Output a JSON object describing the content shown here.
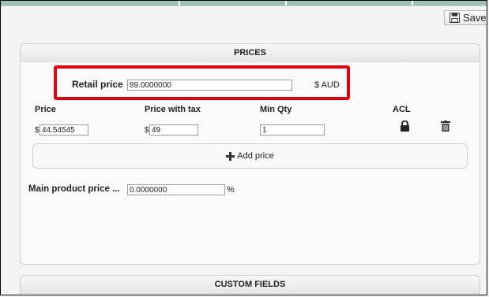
{
  "toolbar": {
    "save_label": "Save"
  },
  "prices_panel": {
    "title": "PRICES",
    "retail_price": {
      "label": "Retail price",
      "value": "89.0000000",
      "currency": "$ AUD"
    },
    "columns": [
      "Price",
      "Price with tax",
      "Min Qty",
      "ACL"
    ],
    "row": {
      "price_prefix": "$",
      "price": "44.54545",
      "price_tax_prefix": "$",
      "price_with_tax": "49",
      "min_qty": "1"
    },
    "add_price_label": "Add price",
    "main_product_price": {
      "label": "Main product price ...",
      "value": "0.0000000",
      "suffix": "%"
    }
  },
  "custom_fields_panel": {
    "title": "CUSTOM FIELDS"
  },
  "icons": {
    "save": "save-icon",
    "acl": "lock-icon",
    "delete": "trash-icon",
    "add": "plus-icon"
  },
  "colors": {
    "highlight": "#e0000f",
    "topbar": "#9ec0b3"
  }
}
